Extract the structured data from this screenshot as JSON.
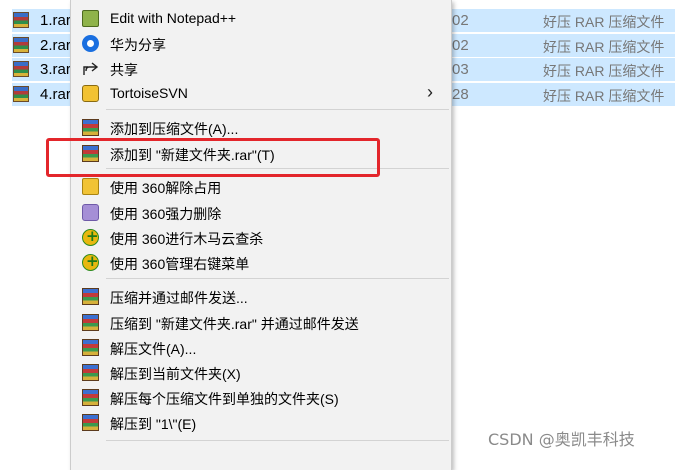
{
  "files": [
    {
      "name": "1.rar",
      "time": "02",
      "type": "好压 RAR 压缩文件"
    },
    {
      "name": "2.rar",
      "time": "02",
      "type": "好压 RAR 压缩文件"
    },
    {
      "name": "3.rar",
      "time": "03",
      "type": "好压 RAR 压缩文件"
    },
    {
      "name": "4.rar",
      "time": "28",
      "type": "好压 RAR 压缩文件"
    }
  ],
  "menu": {
    "items": [
      {
        "label": "Edit with Notepad++",
        "icon": "notepad-plus-plus-icon"
      },
      {
        "label": "华为分享",
        "icon": "huawei-share-icon"
      },
      {
        "label": "共享",
        "icon": "share-icon"
      },
      {
        "label": "TortoiseSVN",
        "icon": "tortoisesvn-icon",
        "submenu": true
      },
      {
        "label": "添加到压缩文件(A)...",
        "icon": "rar-icon"
      },
      {
        "label": "添加到 \"新建文件夹.rar\"(T)",
        "icon": "rar-icon",
        "highlighted": true
      },
      {
        "label": "使用 360解除占用",
        "icon": "360-unlock-icon"
      },
      {
        "label": "使用 360强力删除",
        "icon": "360-shred-icon"
      },
      {
        "label": "使用 360进行木马云查杀",
        "icon": "360-scan-icon"
      },
      {
        "label": "使用 360管理右键菜单",
        "icon": "360-manage-icon"
      },
      {
        "label": "压缩并通过邮件发送...",
        "icon": "rar-icon"
      },
      {
        "label": "压缩到 \"新建文件夹.rar\" 并通过邮件发送",
        "icon": "rar-icon"
      },
      {
        "label": "解压文件(A)...",
        "icon": "rar-icon"
      },
      {
        "label": "解压到当前文件夹(X)",
        "icon": "rar-icon"
      },
      {
        "label": "解压每个压缩文件到单独的文件夹(S)",
        "icon": "rar-icon"
      },
      {
        "label": "解压到 \"1\\\"(E)",
        "icon": "rar-icon"
      }
    ],
    "submenu_arrow": "›",
    "highlight_color": "#e3262b"
  },
  "watermark": "CSDN @奥凯丰科技"
}
